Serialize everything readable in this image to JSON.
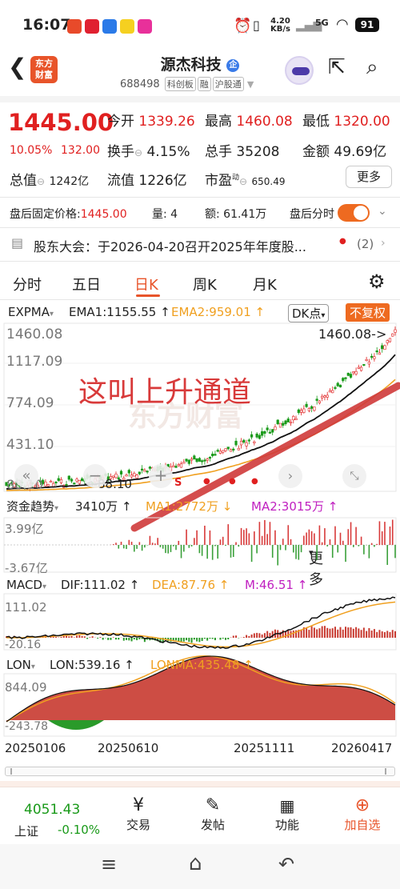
{
  "status_bar": {
    "time": "16:07",
    "net_speed_top": "4.20",
    "net_speed_unit": "KB/s",
    "signal": "5G",
    "battery": "91"
  },
  "header": {
    "title": "源杰科技",
    "badge": "企",
    "code": "688498",
    "tags": [
      "科创板",
      "融",
      "沪股通"
    ],
    "logo_line1": "东方",
    "logo_line2": "财富"
  },
  "quote": {
    "price": "1445.00",
    "change_pct": "10.05%",
    "change_amt": "132.00",
    "open_label": "今开",
    "open": "1339.26",
    "high_label": "最高",
    "high": "1460.08",
    "low_label": "最低",
    "low": "1320.00",
    "turnover_label": "换手",
    "turnover": "4.15%",
    "volume_label": "总手",
    "volume": "35208",
    "amount_label": "金额",
    "amount": "49.69亿",
    "mcap_label": "总值",
    "mcap": "1242亿",
    "float_label": "流值",
    "float": "1226亿",
    "pe_label": "市盈",
    "pe_sup": "动",
    "pe": "650.49",
    "more": "更多"
  },
  "after_hours": {
    "price_label": "盘后固定价格:",
    "price": "1445.00",
    "qty_label": "量:",
    "qty": "4",
    "amt_label": "额:",
    "amt": "61.41万",
    "toggle_label": "盘后分时"
  },
  "notice": {
    "text": "股东大会：于2026-04-20召开2025年年度股...",
    "count": "(2)"
  },
  "tabs": [
    "分时",
    "五日",
    "日K",
    "周K",
    "月K",
    "更多"
  ],
  "active_tab": "日K",
  "main_chart": {
    "indicator": "EXPMA",
    "ema1": "EMA1:1155.55 ↑",
    "ema2": "EMA2:959.01 ↑",
    "dk": "DK点",
    "adjust": "不复权",
    "y_labels": [
      "1460.08",
      "1117.09",
      "774.09",
      "431.10",
      "88.10"
    ],
    "high_marker": "1460.08->",
    "low_marker": "<-88.10",
    "annotation": "这叫上升通道",
    "watermark": "东方财富",
    "colors": {
      "up": "#e02020",
      "down": "#1a9a1a",
      "ema1": "#111111",
      "ema2": "#f0a020"
    }
  },
  "flow_chart": {
    "name": "资金趋势",
    "value": "3410万 ↑",
    "ma1": "MA1:2772万 ↓",
    "ma2": "MA2:3015万 ↑",
    "y_top": "3.99亿",
    "y_bot": "-3.67亿"
  },
  "macd_chart": {
    "name": "MACD",
    "dif": "DIF:111.02 ↑",
    "dea": "DEA:87.76 ↑",
    "m": "M:46.51 ↑",
    "y_top": "111.02",
    "y_bot": "-20.16"
  },
  "lon_chart": {
    "name": "LON",
    "lon": "LON:539.16 ↑",
    "lonma": "LONMA:435.48 ↑",
    "y_top": "844.09",
    "y_bot": "-243.78"
  },
  "x_dates": [
    "20250106",
    "20250610",
    "20251111",
    "20260417"
  ],
  "bottom_nav": {
    "index_value": "4051.43",
    "index_name": "上证",
    "index_change": "-0.10%",
    "items": [
      "交易",
      "发帖",
      "功能",
      "加自选"
    ]
  }
}
